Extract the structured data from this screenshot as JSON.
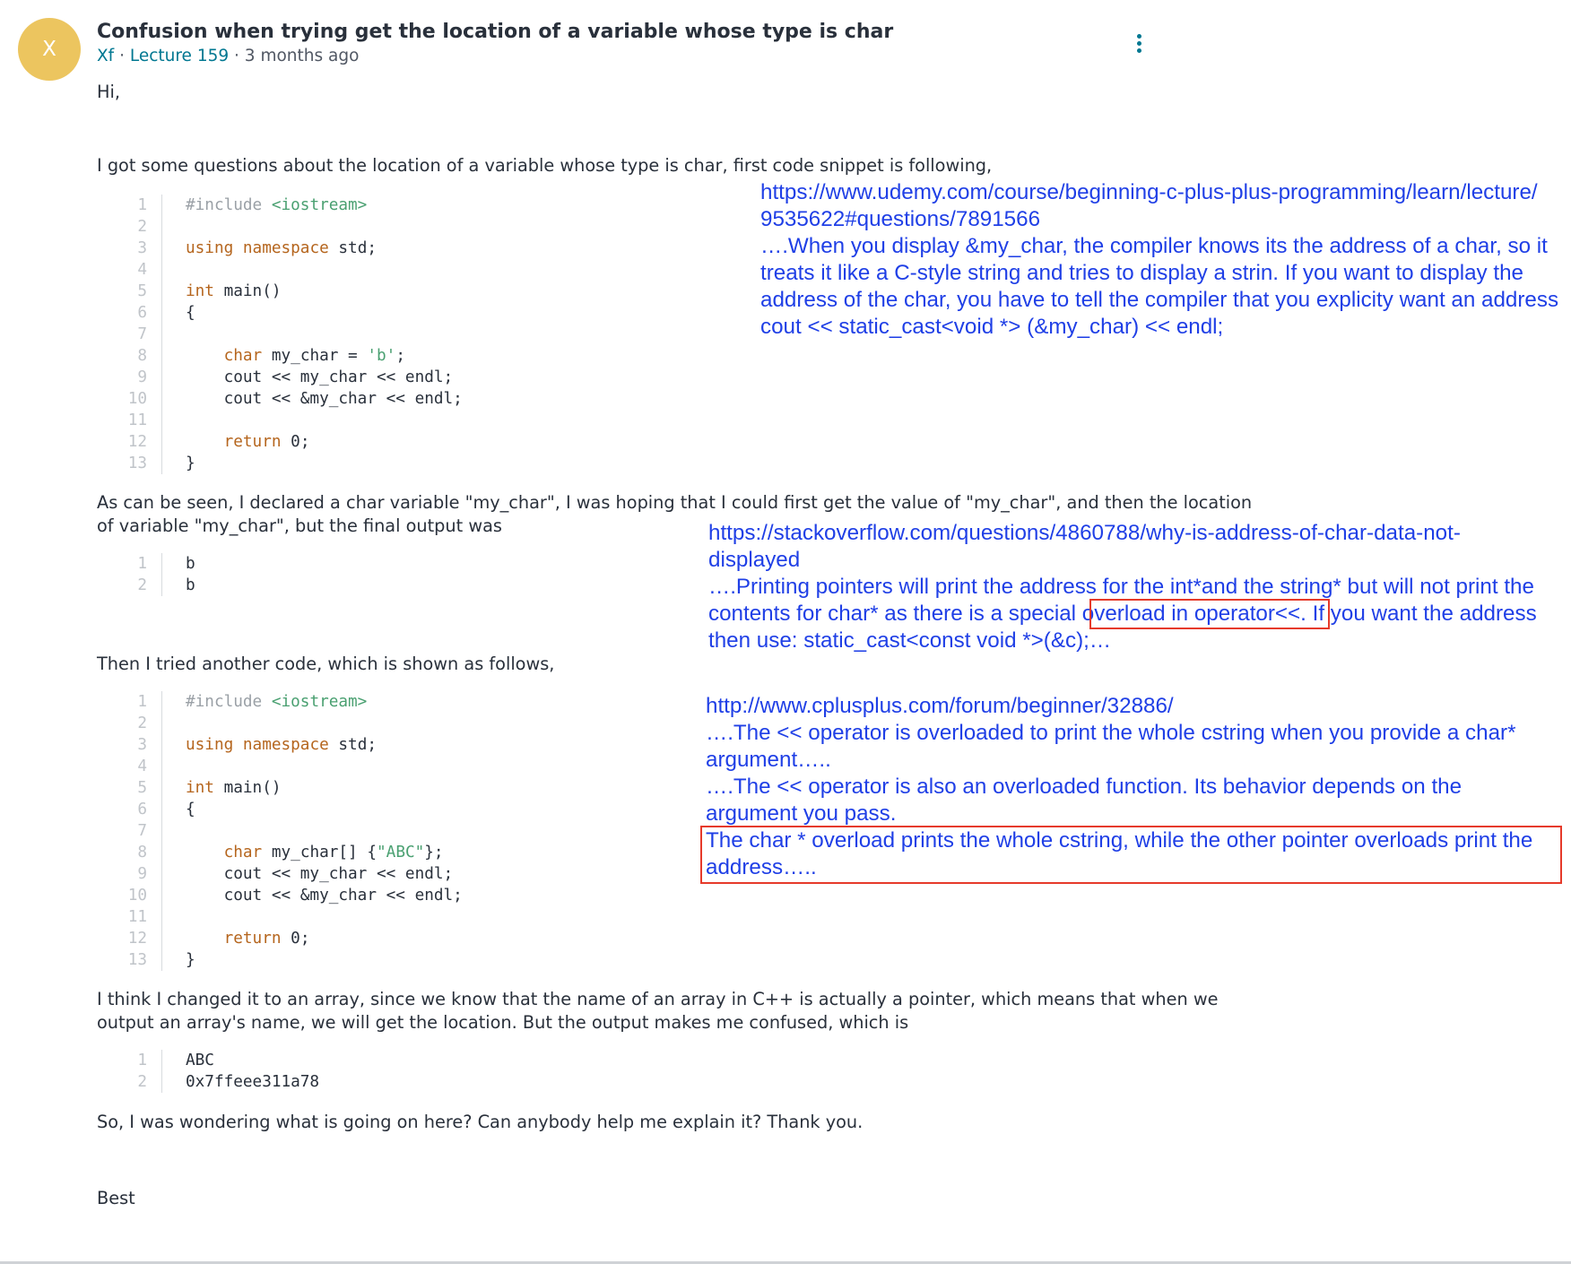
{
  "post": {
    "avatar_letter": "X",
    "title": "Confusion when trying get the location of a variable whose type is char",
    "author": "Xf",
    "separator": " · ",
    "lecture": "Lecture 159",
    "time": "3 months ago",
    "paragraphs": {
      "greeting": "Hi,",
      "intro": "I got some questions about the location of a variable whose type is char,  first  code snippet is following,",
      "seen_1": "As can be seen, I declared a char variable \"my_char\",  I was hoping that I could first get the value of \"my_char\", and then the location",
      "seen_2": "of variable \"my_char\", but the final output was",
      "tried": "Then I tried another code, which is shown as follows,",
      "think_1": "I think I changed it to an array,  since we know that the name of an array in C++ is actually a pointer, which means that when we",
      "think_2": "output an array's name, we will get the location. But the output makes me confused, which is",
      "wonder": "So, I was wondering what is going on here? Can anybody help me explain it? Thank you.",
      "signoff": "Best"
    },
    "code1": [
      {
        "n": "1",
        "t": "#include <iostream>"
      },
      {
        "n": "2",
        "t": ""
      },
      {
        "n": "3",
        "t": "using namespace std;"
      },
      {
        "n": "4",
        "t": ""
      },
      {
        "n": "5",
        "t": "int main()"
      },
      {
        "n": "6",
        "t": "{"
      },
      {
        "n": "7",
        "t": ""
      },
      {
        "n": "8",
        "t": "    char my_char = 'b';"
      },
      {
        "n": "9",
        "t": "    cout << my_char << endl;"
      },
      {
        "n": "10",
        "t": "    cout << &my_char << endl;"
      },
      {
        "n": "11",
        "t": ""
      },
      {
        "n": "12",
        "t": "    return 0;"
      },
      {
        "n": "13",
        "t": "}"
      }
    ],
    "output1": [
      {
        "n": "1",
        "t": "b"
      },
      {
        "n": "2",
        "t": "b"
      }
    ],
    "code2": [
      {
        "n": "1",
        "t": "#include <iostream>"
      },
      {
        "n": "2",
        "t": ""
      },
      {
        "n": "3",
        "t": "using namespace std;"
      },
      {
        "n": "4",
        "t": ""
      },
      {
        "n": "5",
        "t": "int main()"
      },
      {
        "n": "6",
        "t": "{"
      },
      {
        "n": "7",
        "t": ""
      },
      {
        "n": "8",
        "t": "    char my_char[] {\"ABC\"};"
      },
      {
        "n": "9",
        "t": "    cout << my_char << endl;"
      },
      {
        "n": "10",
        "t": "    cout << &my_char << endl;"
      },
      {
        "n": "11",
        "t": ""
      },
      {
        "n": "12",
        "t": "    return 0;"
      },
      {
        "n": "13",
        "t": "}"
      }
    ],
    "output2": [
      {
        "n": "1",
        "t": "ABC"
      },
      {
        "n": "2",
        "t": "0x7ffeee311a78"
      }
    ]
  },
  "annotations": {
    "udemy": [
      "https://www.udemy.com/course/beginning-c-plus-plus-programming/learn/lecture/",
      "9535622#questions/7891566",
      "….When you display &my_char, the compiler knows its the address of a char, so it",
      "treats it like a C-style string and tries to display a strin. If you want to display the",
      "address of the char, you have to tell the compiler that you explicity want an address",
      "cout << static_cast<void *> (&my_char) << endl;"
    ],
    "stackoverflow": {
      "line1": "https://stackoverflow.com/questions/4860788/why-is-address-of-char-data-not-",
      "line2": "displayed",
      "line3": "….Printing pointers will print the address for the int*and the string* but will not print the",
      "line4_pre": "contents for char* as there is a special ",
      "line4_boxed": "overload in operator<<.",
      "line4_post": " If you want the address",
      "line5": "then use: static_cast<const void *>(&c);…"
    },
    "cplusplus": {
      "lines": [
        "http://www.cplusplus.com/forum/beginner/32886/",
        "….The << operator is overloaded to print the whole cstring when you provide a char*",
        "argument…..",
        "….The << operator is also an overloaded function. Its behavior depends on the",
        "argument you pass."
      ],
      "boxed_lines": [
        "The char * overload prints the whole cstring, while the other pointer overloads print the",
        "address….."
      ]
    }
  },
  "colors": {
    "avatar": "#ecc55f",
    "link": "#007791",
    "annotation": "#1f3fe6",
    "highlight_box": "#e63a2a"
  }
}
